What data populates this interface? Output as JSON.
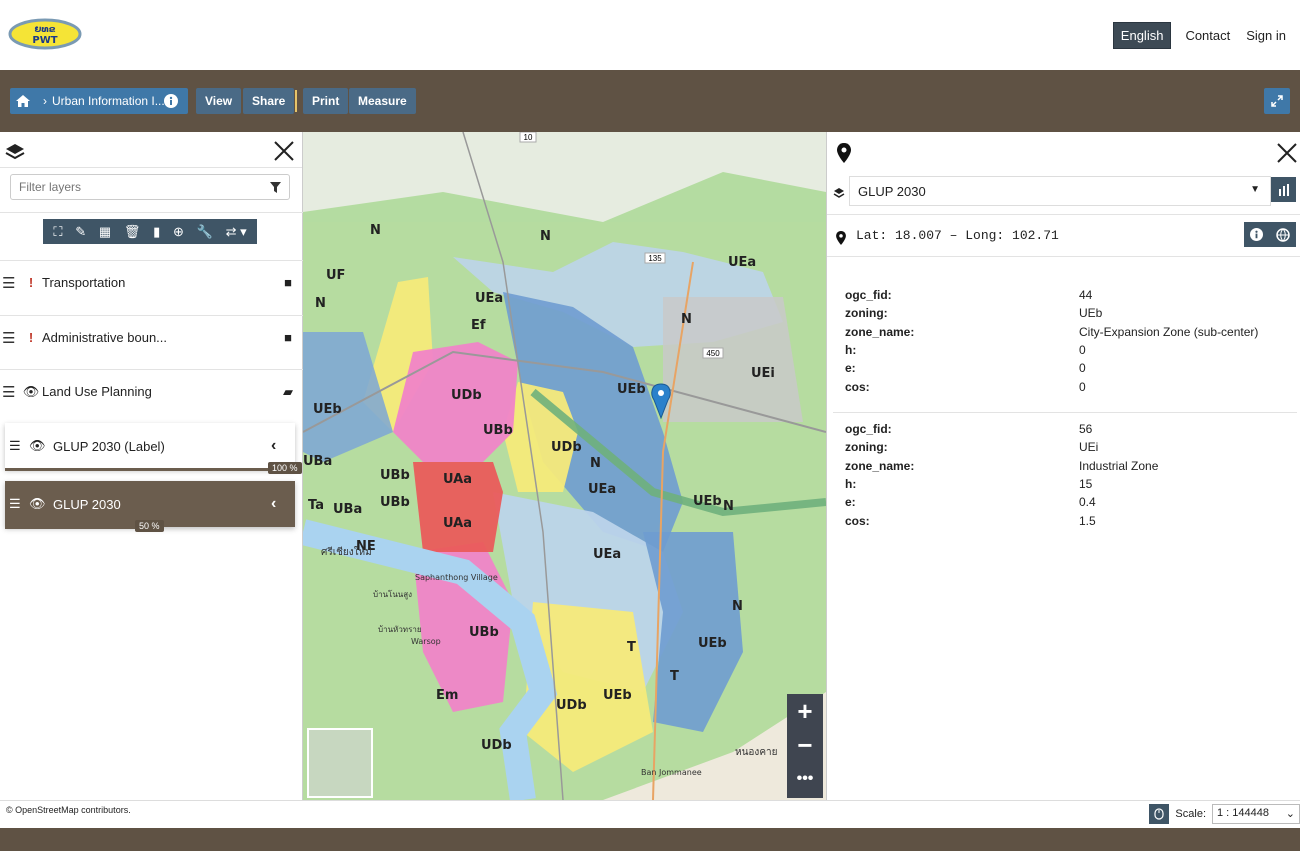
{
  "header": {
    "logo_text": "PWT",
    "logo_script": "ຍທຂ",
    "nav": [
      "English",
      "Contact",
      "Sign in"
    ]
  },
  "toolbar": {
    "breadcrumb": "Urban Information I...",
    "buttons": [
      "View",
      "Share",
      "Print",
      "Measure"
    ]
  },
  "layer_panel": {
    "filter_placeholder": "Filter layers",
    "tools": [
      "zoom-to-extent-icon",
      "eraser-icon",
      "table-icon",
      "trash-icon",
      "chart-icon",
      "download-icon",
      "wrench-icon",
      "swap-icon"
    ],
    "layers": [
      {
        "label": "Transportation",
        "status": "!"
      },
      {
        "label": "Administrative boun...",
        "status": "!"
      },
      {
        "label": "Land Use Planning",
        "status": "visible"
      }
    ],
    "sublayers": [
      {
        "label": "GLUP 2030 (Label)",
        "opacity": "100 %",
        "opacity_value": 1.0
      },
      {
        "label": "GLUP 2030",
        "opacity": "50 %",
        "opacity_value": 0.5
      }
    ]
  },
  "map": {
    "labels": [
      "N",
      "N",
      "UF",
      "N",
      "UEa",
      "Ef",
      "UEa",
      "N",
      "UEb",
      "UEi",
      "UDb",
      "UEb",
      "UBb",
      "UDb",
      "N",
      "UBa",
      "UBb",
      "UAa",
      "UBb",
      "Ta",
      "UBa",
      "UAa",
      "UEa",
      "UEb",
      "N",
      "NE",
      "UEa",
      "N",
      "UBb",
      "UEb",
      "T",
      "T",
      "Em",
      "UDb",
      "UEb",
      "UDb"
    ],
    "place_labels": [
      "ศรีเชียงใหม่",
      "Saphanthong Village",
      "Warsop",
      "บ้านโนนสูง",
      "บ้านหัวทราย",
      "Ban Jommanee",
      "หนองคาย"
    ],
    "road_labels": [
      "10",
      "135",
      "450"
    ],
    "attribution": "© OpenStreetMap contributors."
  },
  "info_panel": {
    "layer_select": "GLUP 2030",
    "coords": "Lat: 18.007 – Long: 102.71",
    "features": [
      {
        "rows": [
          {
            "key": "ogc_fid:",
            "value": "44"
          },
          {
            "key": "zoning:",
            "value": "UEb"
          },
          {
            "key": "zone_name:",
            "value": "City-Expansion Zone (sub-center)"
          },
          {
            "key": "h:",
            "value": "0"
          },
          {
            "key": "e:",
            "value": "0"
          },
          {
            "key": "cos:",
            "value": "0"
          }
        ]
      },
      {
        "rows": [
          {
            "key": "ogc_fid:",
            "value": "56"
          },
          {
            "key": "zoning:",
            "value": "UEi"
          },
          {
            "key": "zone_name:",
            "value": "Industrial Zone"
          },
          {
            "key": "h:",
            "value": "15"
          },
          {
            "key": "e:",
            "value": "0.4"
          },
          {
            "key": "cos:",
            "value": "1.5"
          }
        ]
      }
    ]
  },
  "footer": {
    "scale_label": "Scale:",
    "scale_value": "1 : 144448"
  },
  "colors": {
    "brand_brown": "#5f5244",
    "button_blue": "#3f78a8",
    "tool_dark": "#3f5566"
  }
}
